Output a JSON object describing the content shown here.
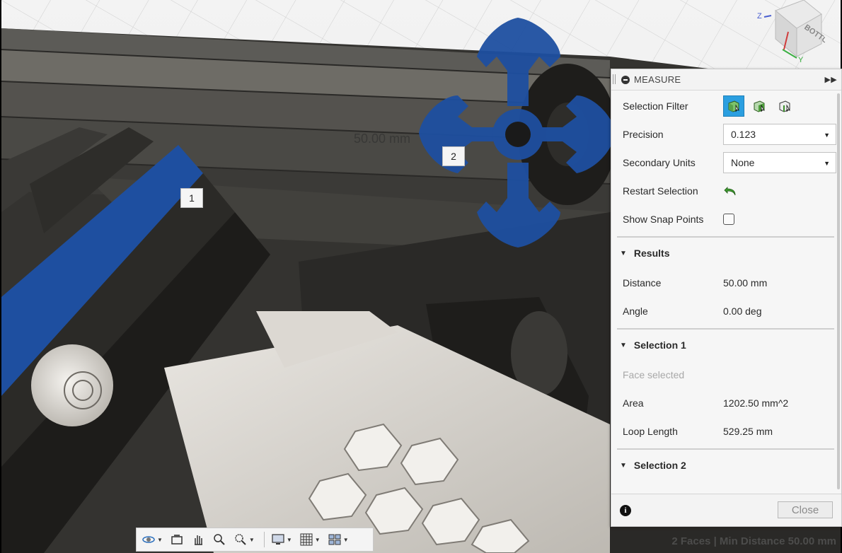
{
  "viewport": {
    "dimension_label": "50.00 mm",
    "selection_tags": [
      "1",
      "2"
    ],
    "viewcube": {
      "face_label": "BOTTOM",
      "axes": [
        "Z",
        "X",
        "Y"
      ]
    }
  },
  "measure": {
    "title": "MEASURE",
    "selection_filter_label": "Selection Filter",
    "filter_icons": [
      "select-body-icon",
      "select-face-icon",
      "select-edge-icon"
    ],
    "precision_label": "Precision",
    "precision_value": "0.123",
    "secondary_units_label": "Secondary Units",
    "secondary_units_value": "None",
    "restart_selection_label": "Restart Selection",
    "show_snap_points_label": "Show Snap Points",
    "show_snap_points_checked": false,
    "results": {
      "title": "Results",
      "distance_label": "Distance",
      "distance_value": "50.00 mm",
      "angle_label": "Angle",
      "angle_value": "0.00 deg"
    },
    "selection1": {
      "title": "Selection 1",
      "status": "Face selected",
      "area_label": "Area",
      "area_value": "1202.50 mm^2",
      "loop_label": "Loop Length",
      "loop_value": "529.25 mm"
    },
    "selection2": {
      "title": "Selection 2"
    },
    "close_label": "Close"
  },
  "toolbar": {
    "icons": [
      "orbit-icon",
      "look-at-icon",
      "pan-icon",
      "zoom-icon",
      "fit-icon",
      "display-settings-icon",
      "grid-icon",
      "viewports-icon"
    ]
  },
  "status_bar": {
    "text": "2 Faces | Min Distance 50.00 mm"
  },
  "colors": {
    "selection_blue": "#1e4fa0",
    "accent": "#2b9fe0"
  }
}
